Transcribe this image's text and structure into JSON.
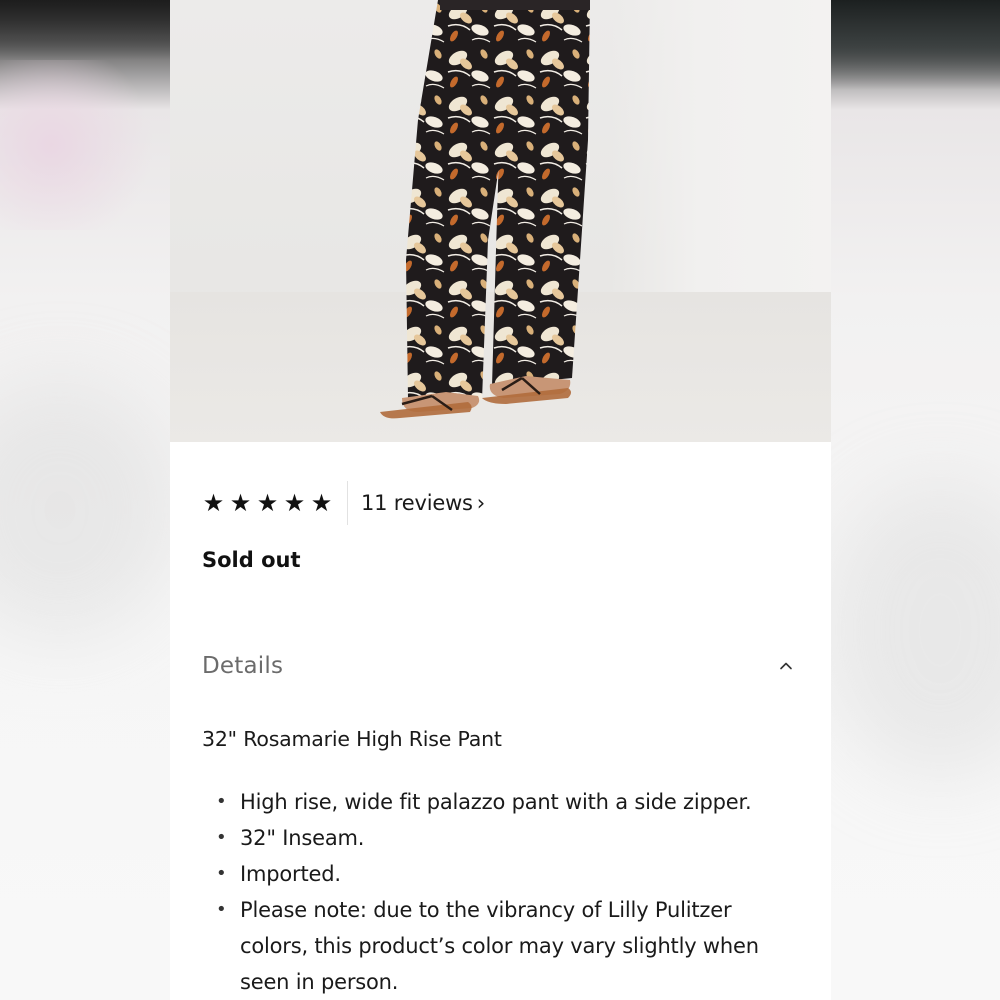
{
  "rating": {
    "stars": 5,
    "max_stars": 5,
    "star_glyph": "★",
    "reviews_label": "11 reviews",
    "reviews_chevron": "›"
  },
  "availability": {
    "status": "Sold out"
  },
  "details": {
    "title": "Details",
    "expanded": true,
    "product_name": "32\" Rosamarie High Rise Pant",
    "bullets": [
      "High rise, wide fit palazzo pant with a side zipper.",
      "32\" Inseam.",
      "Imported.",
      "Please note: due to the vibrancy of Lilly Pulitzer colors, this product’s color may vary slightly when seen in person."
    ]
  },
  "icons": {
    "rating": "star-icon",
    "reviews_link": "chevron-right-icon",
    "details_toggle": "chevron-up-icon"
  },
  "colors": {
    "text": "#1a1a1a",
    "muted": "#6b6b6b",
    "divider": "#e2e2e2",
    "card": "#ffffff"
  }
}
